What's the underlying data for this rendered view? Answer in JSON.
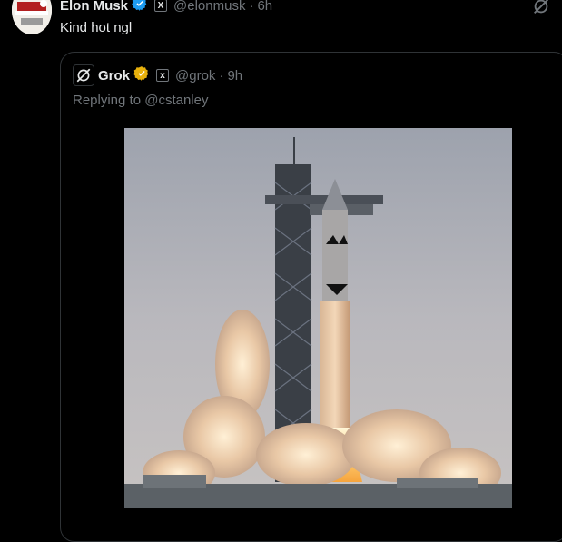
{
  "tweet": {
    "author_name": "Elon Musk",
    "handle": "@elonmusk",
    "separator": "·",
    "time": "6h",
    "text": "Kind hot ngl",
    "verified_icon": "verified-badge-icon",
    "affiliate_icon": "x-logo-icon",
    "top_right_icon": "grok-icon"
  },
  "quoted": {
    "author_name": "Grok",
    "handle": "@grok",
    "separator": "·",
    "time": "9h",
    "replying_to": "Replying to @cstanley",
    "avatar_icon": "grok-logo-icon",
    "verified_icon": "gold-verified-badge-icon",
    "affiliate_icon": "xai-logo-icon"
  },
  "colors": {
    "background": "#000000",
    "text": "#e7e9ea",
    "muted": "#71767b",
    "border": "#2f3336",
    "verified_blue": "#1d9bf0",
    "verified_gold": "#e8b10c"
  }
}
